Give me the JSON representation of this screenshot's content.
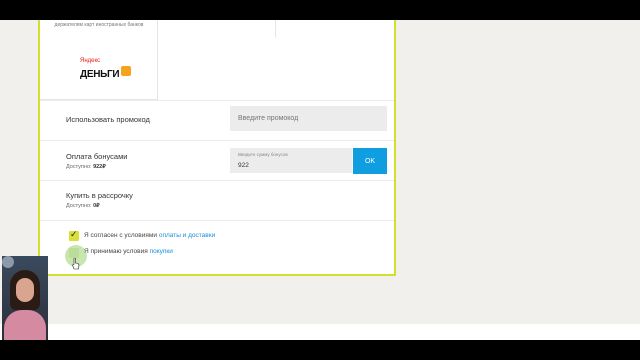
{
  "payment_methods": {
    "foreign_cards_note": "держателям карт иностранных банков",
    "yandex_logo": {
      "small_text": "Яндекс",
      "big_text": "ДЕНЬГИ"
    }
  },
  "promo": {
    "label": "Использовать промокод",
    "placeholder": "Введите промокод"
  },
  "bonuses": {
    "label": "Оплата бонусами",
    "available_label": "Доступно:",
    "available_value": "922₽",
    "input_hint": "Введите сумму бонусов",
    "input_value": "922",
    "ok_label": "OK"
  },
  "installment": {
    "label": "Купить в рассрочку",
    "available_label": "Доступно:",
    "available_value": "0₽"
  },
  "agreements": {
    "first_text": "Я согласен с условиями",
    "first_link": "оплаты и доставки",
    "first_checked": true,
    "second_text": "Я принимаю условия",
    "second_link": "покупки",
    "second_checked": false
  },
  "colors": {
    "accent_border": "#d3df2c",
    "ok_button": "#0f9fe0",
    "link": "#1a8fd8"
  }
}
